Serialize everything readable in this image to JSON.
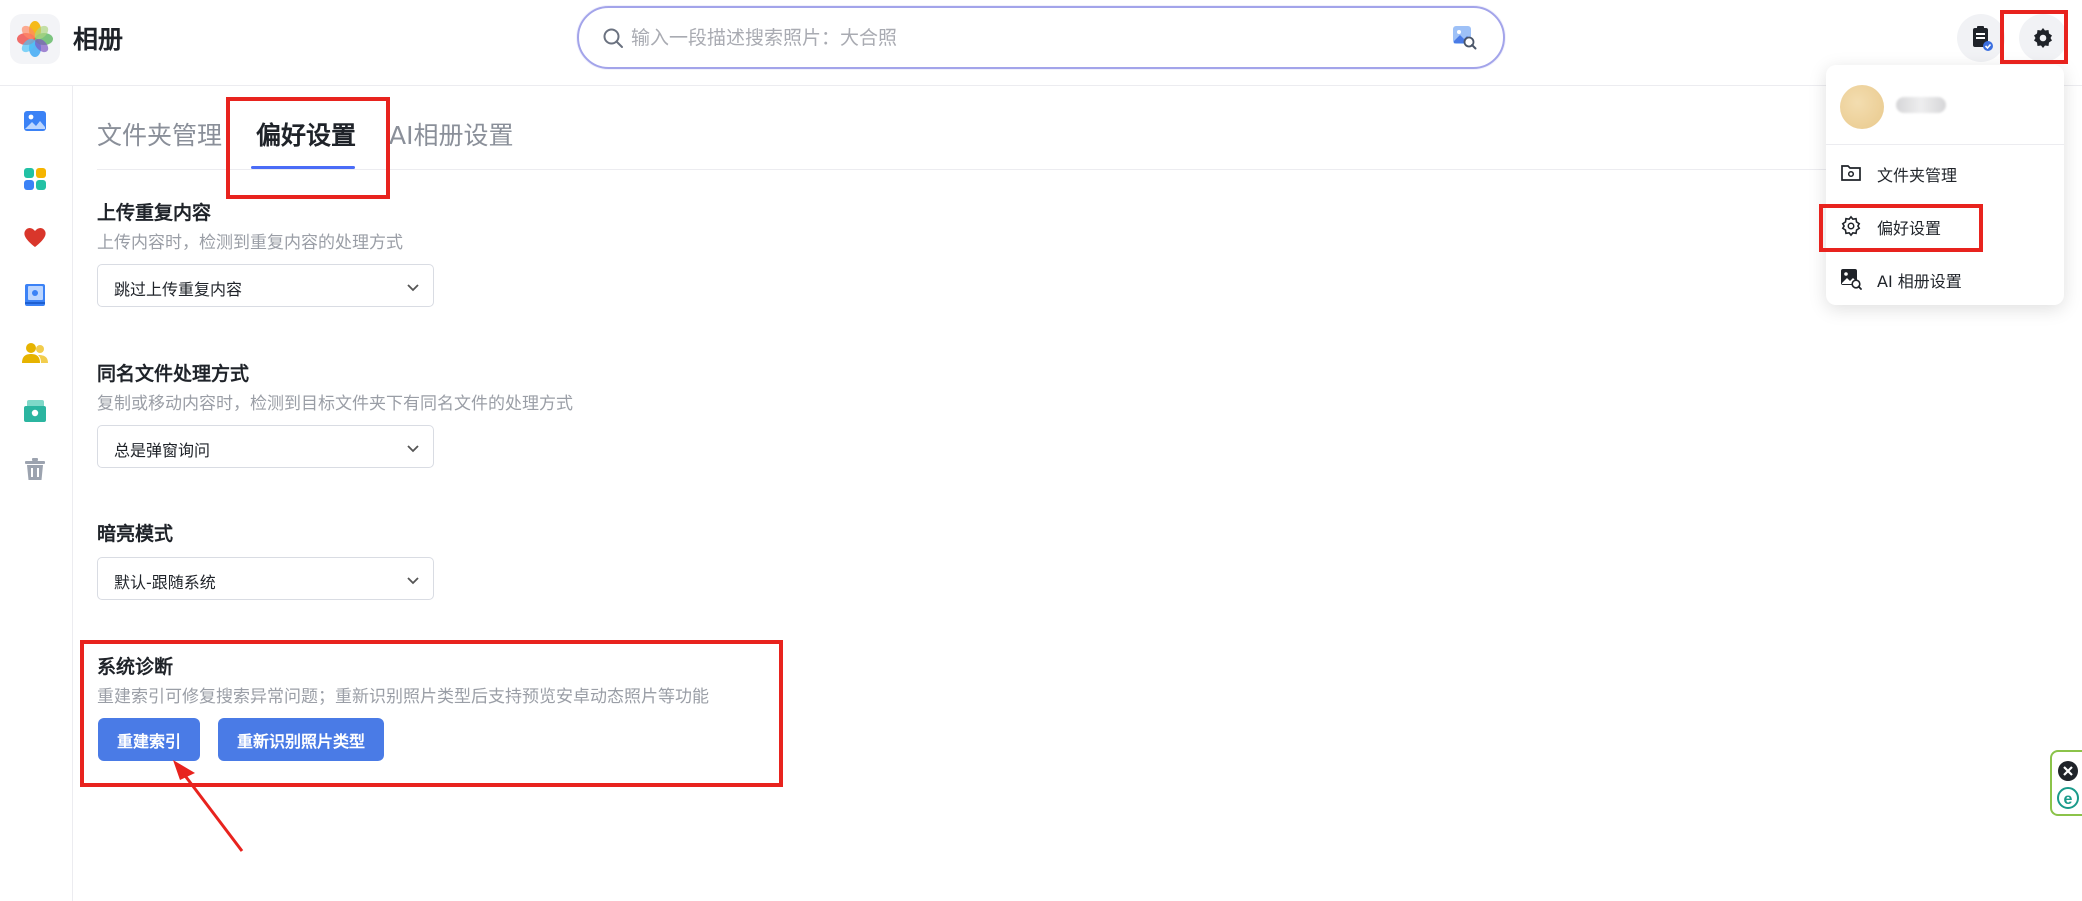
{
  "app": {
    "title": "相册"
  },
  "search": {
    "placeholder": "输入一段描述搜索照片：大合照"
  },
  "header": {
    "tasks_icon": "clipboard-check-icon",
    "settings_icon": "gear-icon"
  },
  "sidebar": {
    "items": [
      {
        "name": "photos",
        "icon": "image-icon",
        "color": "#3b82f6"
      },
      {
        "name": "albums",
        "icon": "grid-icon",
        "color": "#22c1a4"
      },
      {
        "name": "favorites",
        "icon": "heart-icon",
        "color": "#d9362b"
      },
      {
        "name": "memories",
        "icon": "book-icon",
        "color": "#3b82f6"
      },
      {
        "name": "people",
        "icon": "people-icon",
        "color": "#e6b300"
      },
      {
        "name": "shared",
        "icon": "shared-album-icon",
        "color": "#2bb5a0"
      },
      {
        "name": "trash",
        "icon": "trash-icon",
        "color": "#9ca3af"
      }
    ]
  },
  "tabs": [
    {
      "label": "文件夹管理",
      "active": false
    },
    {
      "label": "偏好设置",
      "active": true
    },
    {
      "label": "AI相册设置",
      "active": false
    }
  ],
  "settings": {
    "duplicate": {
      "title": "上传重复内容",
      "desc": "上传内容时，检测到重复内容的处理方式",
      "value": "跳过上传重复内容"
    },
    "same_name": {
      "title": "同名文件处理方式",
      "desc": "复制或移动内容时，检测到目标文件夹下有同名文件的处理方式",
      "value": "总是弹窗询问"
    },
    "theme": {
      "title": "暗亮模式",
      "value": "默认-跟随系统"
    },
    "diagnostics": {
      "title": "系统诊断",
      "desc": "重建索引可修复搜索异常问题；重新识别照片类型后支持预览安卓动态照片等功能",
      "rebuild_label": "重建索引",
      "reidentify_label": "重新识别照片类型"
    }
  },
  "menu": {
    "items": [
      {
        "label": "文件夹管理",
        "icon": "folder-settings-icon"
      },
      {
        "label": "偏好设置",
        "icon": "gear-icon"
      },
      {
        "label": "AI 相册设置",
        "icon": "image-search-icon"
      }
    ]
  },
  "colors": {
    "accent": "#4a7be6",
    "tab_underline": "#4a6cf7",
    "annotation": "#e8231e"
  }
}
